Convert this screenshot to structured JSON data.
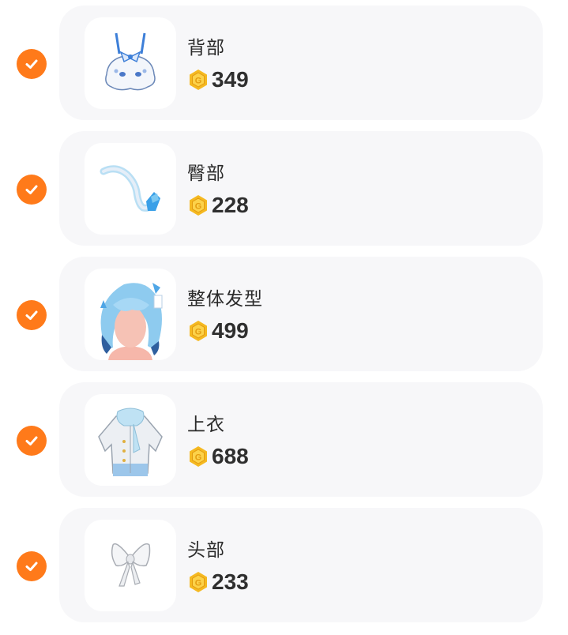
{
  "items": [
    {
      "name": "背部",
      "price": "349",
      "icon": "backpack-plush-icon"
    },
    {
      "name": "臀部",
      "price": "228",
      "icon": "tail-icon"
    },
    {
      "name": "整体发型",
      "price": "499",
      "icon": "hairstyle-icon"
    },
    {
      "name": "上衣",
      "price": "688",
      "icon": "jacket-icon"
    },
    {
      "name": "头部",
      "price": "233",
      "icon": "bow-icon"
    }
  ],
  "colors": {
    "check": "#ff7a1a",
    "coin": "#f5b921",
    "card": "#f7f7f9"
  }
}
